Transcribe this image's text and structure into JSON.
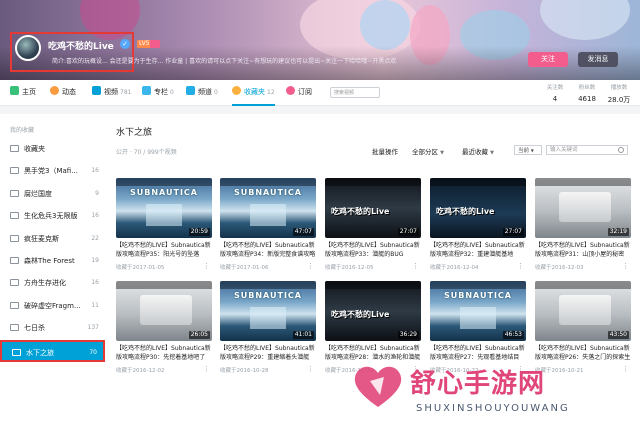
{
  "profile": {
    "username": "吃鸡不愁的Live",
    "level": "LV5",
    "bio": "简介:喜欢的玩概设... 会还是要为于生存... 作业童 | 喜欢的请可以点下关注~有想玩的建议也可以提出~关注一下哈哈哦~开黑点欢",
    "follow_label": "关注",
    "message_label": "发消息"
  },
  "nav": {
    "items": [
      {
        "label": "主页",
        "count": ""
      },
      {
        "label": "动态",
        "count": ""
      },
      {
        "label": "视频",
        "count": "781"
      },
      {
        "label": "专栏",
        "count": "0"
      },
      {
        "label": "频道",
        "count": "0"
      },
      {
        "label": "收藏夹",
        "count": "12"
      },
      {
        "label": "订阅",
        "count": ""
      }
    ],
    "search_placeholder": "搜索视频"
  },
  "stats": [
    {
      "label": "关注数",
      "value": "4"
    },
    {
      "label": "粉丝数",
      "value": "4618"
    },
    {
      "label": "播放数",
      "value": "28.0万"
    }
  ],
  "sidebar": {
    "title": "我的收藏",
    "items": [
      {
        "label": "收藏夹",
        "count": ""
      },
      {
        "label": "黑手党3（Mafi...",
        "count": "16"
      },
      {
        "label": "腐烂国度",
        "count": "9"
      },
      {
        "label": "生化危兵3无限版",
        "count": "16"
      },
      {
        "label": "疯狂麦克斯",
        "count": "22"
      },
      {
        "label": "森林The Forest",
        "count": "19"
      },
      {
        "label": "方舟生存进化",
        "count": "16"
      },
      {
        "label": "破碎虚空Fragm...",
        "count": "11"
      },
      {
        "label": "七日杀",
        "count": "137"
      },
      {
        "label": "水下之旅",
        "count": "70"
      }
    ]
  },
  "main": {
    "title": "水下之旅",
    "subtitle": "公开 · 70 / 999个视频",
    "batch_label": "批量操作",
    "zone_label": "全部分区",
    "sort_label": "最近收藏",
    "scope_label": "当前",
    "keyword_placeholder": "输入关键词"
  },
  "videos": [
    {
      "title": "【吃鸡不愁的LIVE】Subnautica新版攻略流程P35：阳光号的坠落",
      "date": "收藏于2017-01-05",
      "duration": "20:59"
    },
    {
      "title": "【吃鸡不愁的LIVE】Subnautica新版攻略流程P34：新版完整食谱攻略",
      "date": "收藏于2017-01-06",
      "duration": "47:07"
    },
    {
      "title": "【吃鸡不愁的LIVE】Subnautica新版攻略流程P33：潜艇的BUG",
      "date": "收藏于2016-12-05",
      "duration": "27:07"
    },
    {
      "title": "【吃鸡不愁的LIVE】Subnautica新版攻略流程P32：重建潜艇基地",
      "date": "收藏于2016-12-04",
      "duration": "27:07"
    },
    {
      "title": "【吃鸡不愁的LIVE】Subnautica新版攻略流程P31：山顶小屋的秘密",
      "date": "收藏于2016-12-03",
      "duration": "32:19"
    },
    {
      "title": "【吃鸡不愁的LIVE】Subnautica新版攻略流程P30：先挖着基地吧了",
      "date": "收藏于2016-12-02",
      "duration": "26:05"
    },
    {
      "title": "【吃鸡不愁的LIVE】Subnautica新版攻略流程P29：重建缩着头潜艇",
      "date": "收藏于2016-10-28",
      "duration": "41:01"
    },
    {
      "title": "【吃鸡不愁的LIVE】Subnautica新版攻略流程P28：潜水的渔轮和潜艇",
      "date": "收藏于2016-10-13",
      "duration": "36:29"
    },
    {
      "title": "【吃鸡不愁的LIVE】Subnautica新版攻略流程P27：先观看基地结目",
      "date": "收藏于2016-10-22",
      "duration": "46:53"
    },
    {
      "title": "【吃鸡不愁的LIVE】Subnautica新版攻略流程P26：失落之门的探索生",
      "date": "收藏于2016-10-21",
      "duration": "43:50"
    }
  ],
  "watermark": {
    "text": "舒心手游网",
    "sub": "SHUXINSHOUYOUWANG"
  },
  "colors": {
    "accent": "#00a1d6",
    "pink": "#f25d8e",
    "highlight": "#e53935"
  }
}
